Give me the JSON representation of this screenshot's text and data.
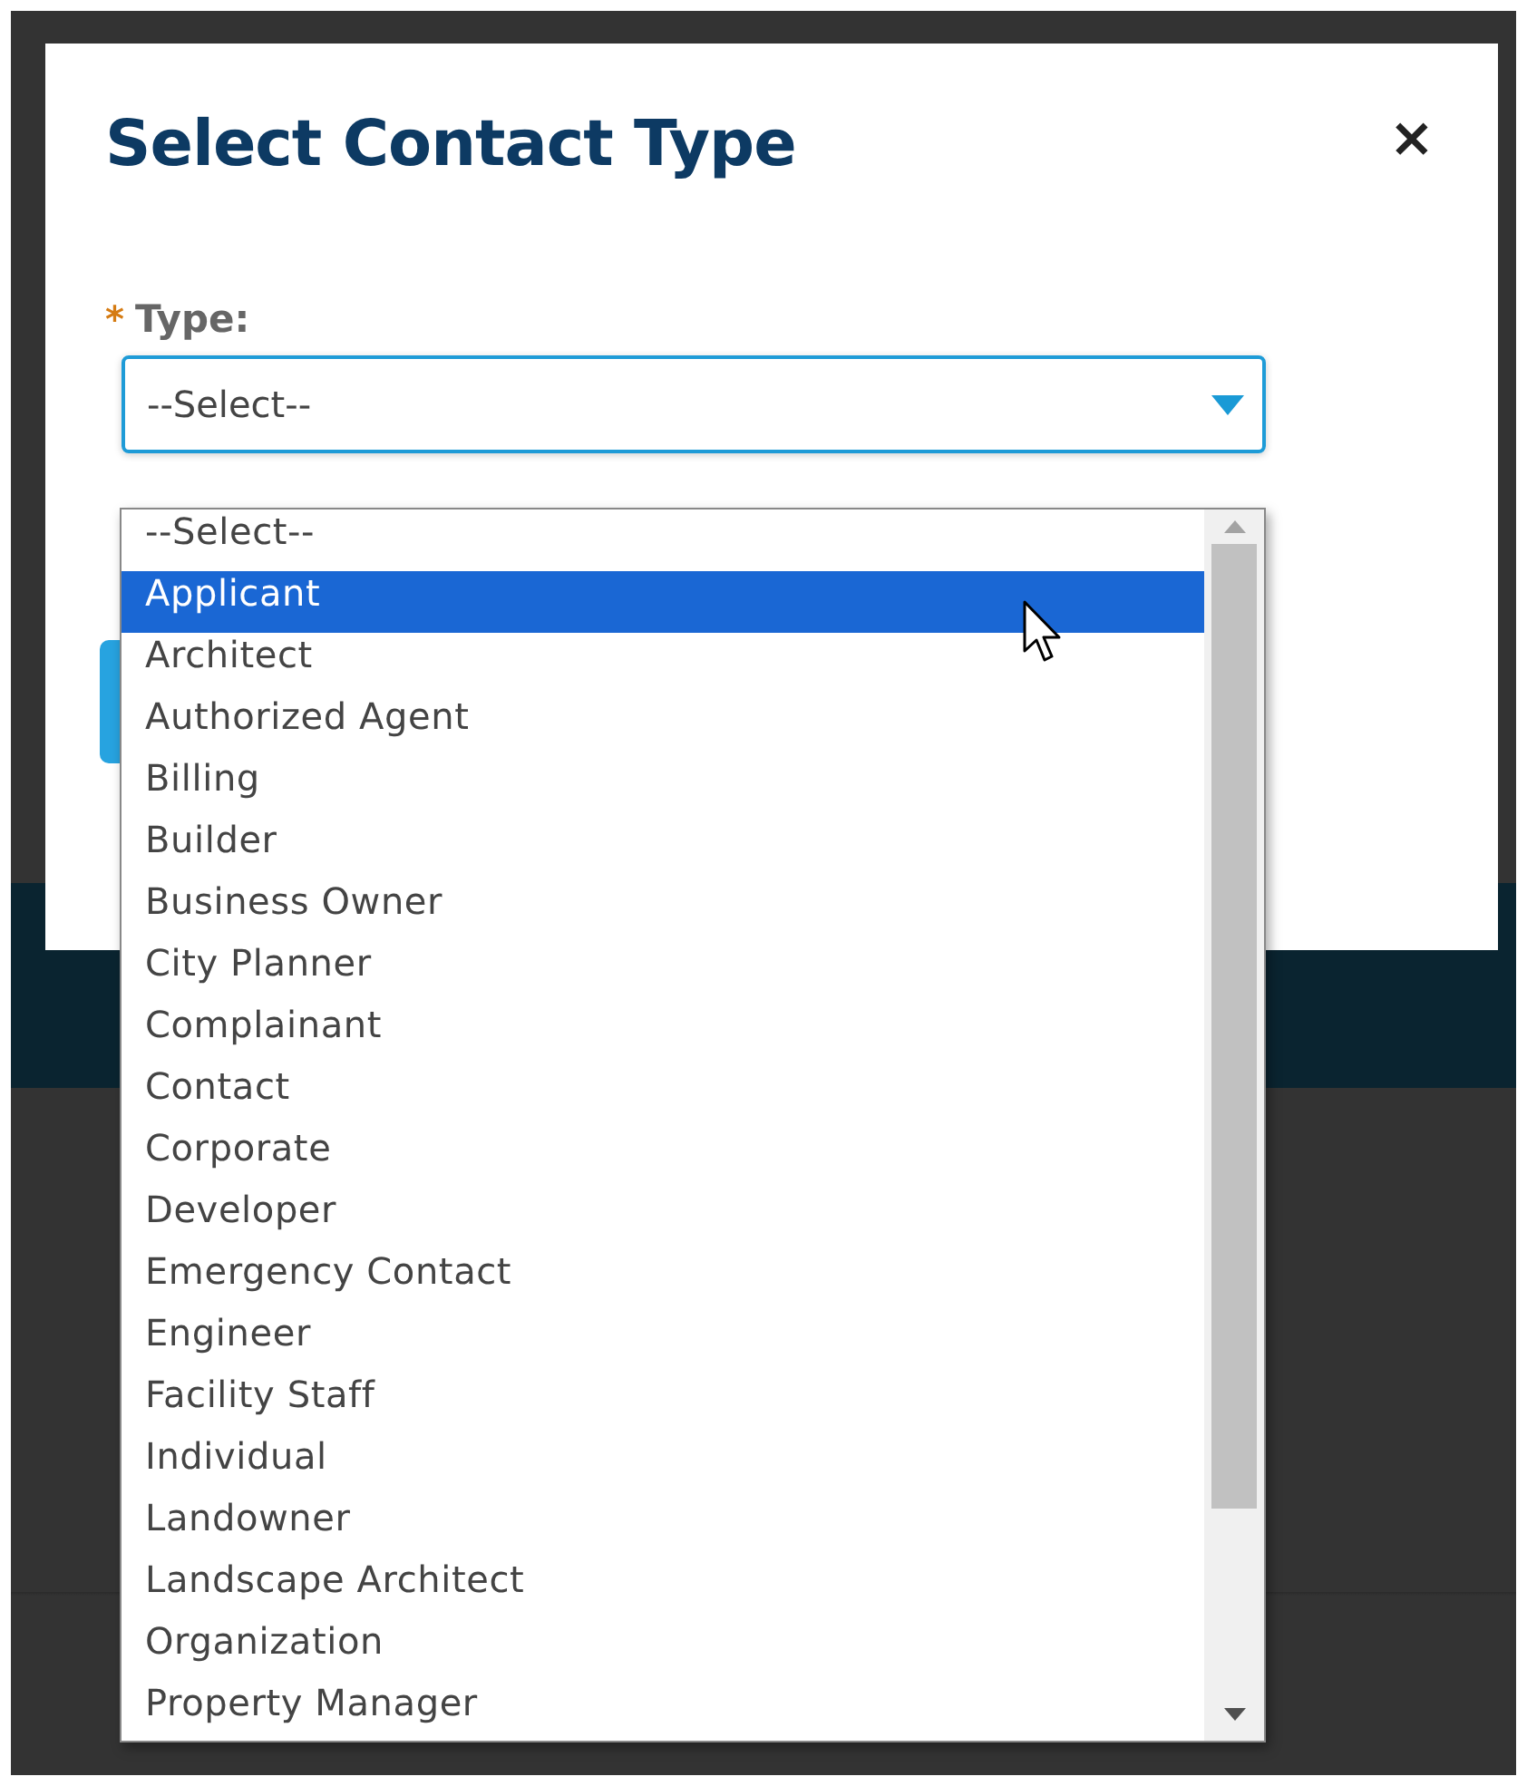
{
  "dialog": {
    "title": "Select Contact Type",
    "close": "×"
  },
  "field": {
    "required": "*",
    "label": "Type:",
    "value": "--Select--"
  },
  "options": [
    {
      "label": "--Select--",
      "selected": false
    },
    {
      "label": "Applicant",
      "selected": true
    },
    {
      "label": "Architect",
      "selected": false
    },
    {
      "label": "Authorized Agent",
      "selected": false
    },
    {
      "label": "Billing",
      "selected": false
    },
    {
      "label": "Builder",
      "selected": false
    },
    {
      "label": "Business Owner",
      "selected": false
    },
    {
      "label": "City Planner",
      "selected": false
    },
    {
      "label": "Complainant",
      "selected": false
    },
    {
      "label": "Contact",
      "selected": false
    },
    {
      "label": "Corporate",
      "selected": false
    },
    {
      "label": "Developer",
      "selected": false
    },
    {
      "label": "Emergency Contact",
      "selected": false
    },
    {
      "label": "Engineer",
      "selected": false
    },
    {
      "label": "Facility Staff",
      "selected": false
    },
    {
      "label": "Individual",
      "selected": false
    },
    {
      "label": "Landowner",
      "selected": false
    },
    {
      "label": "Landscape Architect",
      "selected": false
    },
    {
      "label": "Organization",
      "selected": false
    },
    {
      "label": "Property Manager",
      "selected": false
    }
  ]
}
